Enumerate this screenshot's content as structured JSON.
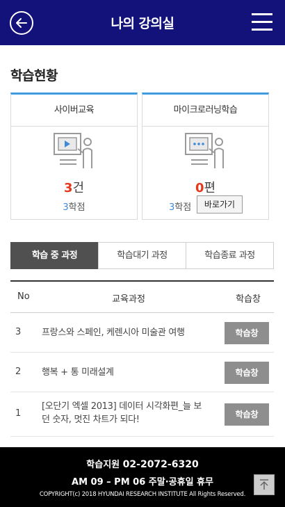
{
  "header": {
    "title": "나의 강의실",
    "back_icon": "back-arrow-icon",
    "menu_icon": "hamburger-menu-icon"
  },
  "status": {
    "title": "학습현황",
    "cyber": {
      "label": "사이버교육",
      "count": "3",
      "count_unit": "건",
      "credit": "3",
      "credit_unit": "학점",
      "icon": "lecture-play-icon"
    },
    "micro": {
      "label": "마이크로러닝학습",
      "count": "0",
      "count_unit": "편",
      "credit": "3",
      "credit_unit": "학점",
      "button": "바로가기",
      "icon": "lecture-dots-icon"
    }
  },
  "tabs": [
    {
      "label": "학습 중 과정",
      "active": true
    },
    {
      "label": "학습대기 과정",
      "active": false
    },
    {
      "label": "학습종료 과정",
      "active": false
    }
  ],
  "table": {
    "headers": {
      "no": "No",
      "course": "교육과정",
      "action": "학습창"
    },
    "rows": [
      {
        "no": "3",
        "title": "프랑스와 스페인, 케렌시아 미술관 여행",
        "button": "학습창"
      },
      {
        "no": "2",
        "title": "행복 + 통 미래설계",
        "button": "학습창"
      },
      {
        "no": "1",
        "title": "[오단기 엑셀 2013] 데이터 시각화편_늘 보던 숫자, 멋진 차트가 되다!",
        "button": "학습창"
      }
    ]
  },
  "footer": {
    "phone_label": "학습지원",
    "phone": "02-2072-6320",
    "hours": "AM 09 – PM 06 주말·공휴일 휴무",
    "copyright": "COPYRIGHT(c) 2018 HYUNDAI RESEARCH INSTITUTE All Rights Reserved."
  },
  "colors": {
    "header_bg": "#12127a",
    "card_accent": "#3f9be0",
    "count_red": "#e5371b",
    "credit_blue": "#3f8ad8",
    "active_tab": "#505050",
    "row_button": "#8e8e8e"
  }
}
